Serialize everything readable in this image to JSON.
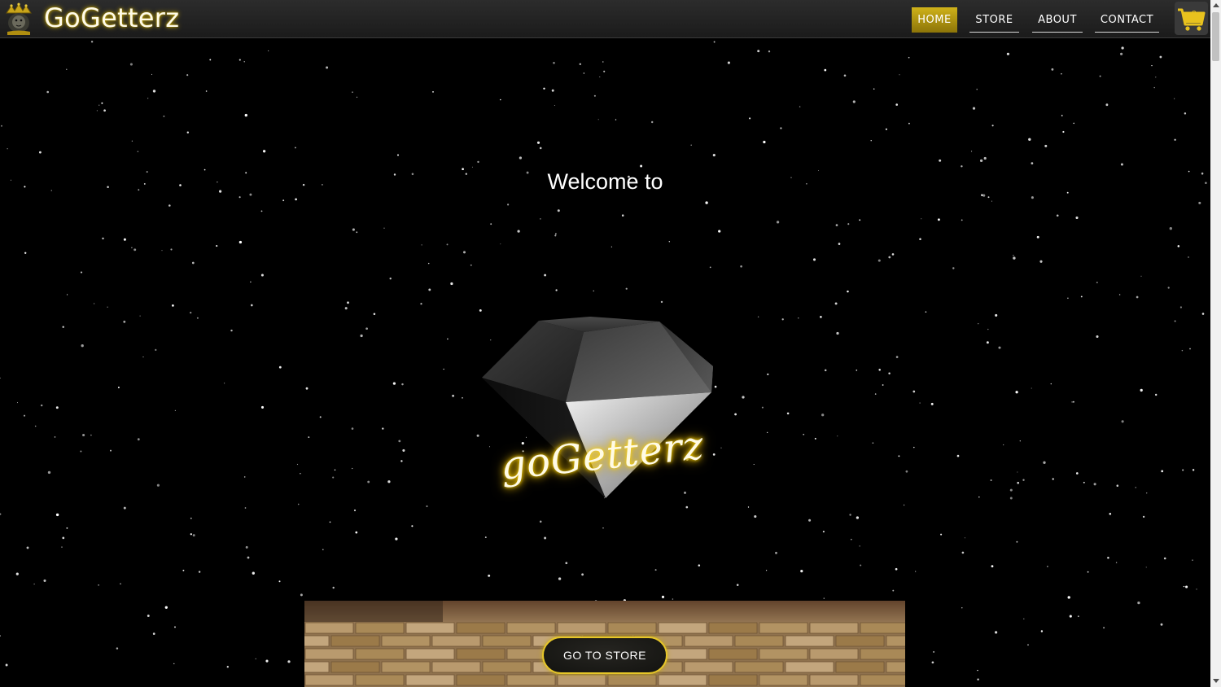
{
  "brand": {
    "name": "GoGetterz"
  },
  "nav": {
    "items": [
      {
        "label": "HOME",
        "active": true
      },
      {
        "label": "STORE",
        "active": false
      },
      {
        "label": "ABOUT",
        "active": false
      },
      {
        "label": "CONTACT",
        "active": false
      }
    ],
    "cart_count": "0"
  },
  "hero": {
    "welcome_text": "Welcome to",
    "script_logo_text": "goGetterz"
  },
  "banner": {
    "button_label": "GO TO STORE"
  },
  "colors": {
    "accent_gold": "#d4b41c",
    "nav_bg": "#222222",
    "page_bg": "#000000"
  },
  "icons": {
    "brand_logo": "crown-lion-logo-icon",
    "cart": "shopping-cart-icon"
  }
}
